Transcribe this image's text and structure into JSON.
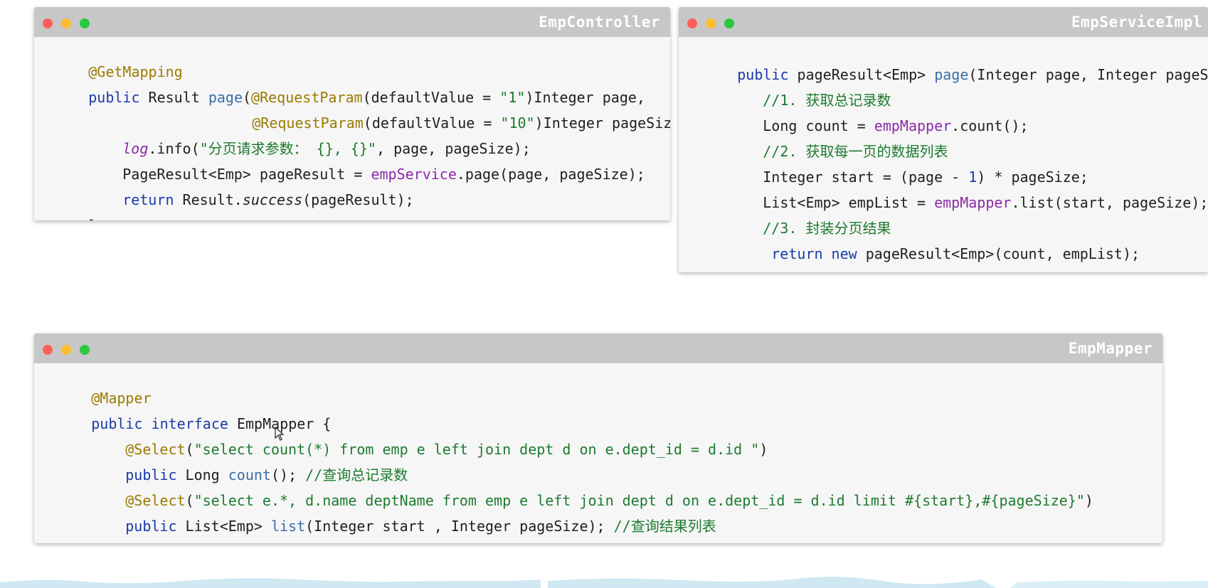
{
  "controller": {
    "title": "EmpController",
    "lines": [
      [
        "@GetMapping"
      ],
      [
        "public",
        " Result ",
        "page",
        "(",
        "@RequestParam",
        "(defaultValue = ",
        "\"1\"",
        ")Integer page,"
      ],
      [
        "@RequestParam",
        "(defaultValue = ",
        "\"10\"",
        ")Integer pageSize) {"
      ],
      [
        "log",
        ".info(",
        "\"分页请求参数： {}, {}\"",
        ", page, pageSize);"
      ],
      [
        "PageResult<Emp> pageResult = ",
        "empService",
        ".page(page, pageSize);"
      ],
      [
        "return",
        " Result.",
        "success",
        "(pageResult);"
      ],
      [
        "}"
      ]
    ]
  },
  "service": {
    "title": "EmpServiceImpl",
    "lines": [
      [
        "public",
        " pageResult<Emp> ",
        "page",
        "(Integer page, Integer pageSize) {"
      ],
      [
        "//1. 获取总记录数"
      ],
      [
        "Long count = ",
        "empMapper",
        ".count();"
      ],
      [
        "//2. 获取每一页的数据列表"
      ],
      [
        "Integer start = (page - ",
        "1",
        ") * pageSize;"
      ],
      [
        "List<Emp> empList = ",
        "empMapper",
        ".list(start, pageSize);"
      ],
      [
        "//3. 封装分页结果"
      ],
      [
        "return",
        " ",
        "new",
        " pageResult<Emp>(count, empList);"
      ],
      [
        "}"
      ]
    ]
  },
  "mapper": {
    "title": "EmpMapper",
    "lines": [
      [
        "@Mapper"
      ],
      [
        "public",
        " ",
        "interface",
        " EmpMapper {"
      ],
      [
        "@Select",
        "(",
        "\"select count(*) from emp e left join dept d on e.dept_id = d.id \"",
        ")"
      ],
      [
        "public",
        " Long ",
        "count",
        "(); ",
        "//查询总记录数"
      ],
      [
        "@Select",
        "(",
        "\"select e.*, d.name deptName from emp e left join dept d on e.dept_id = d.id limit #{start},#{pageSize}\"",
        ")"
      ],
      [
        "public",
        " List<Emp> ",
        "list",
        "(Integer start , Integer pageSize); ",
        "//查询结果列表"
      ],
      [
        "}"
      ]
    ]
  },
  "colors": {
    "titlebar": "#c7c7c7",
    "keyword": "#1a3aa8",
    "annotation": "#9b7a00",
    "string": "#1d7b2f",
    "field": "#8a2aa8"
  }
}
